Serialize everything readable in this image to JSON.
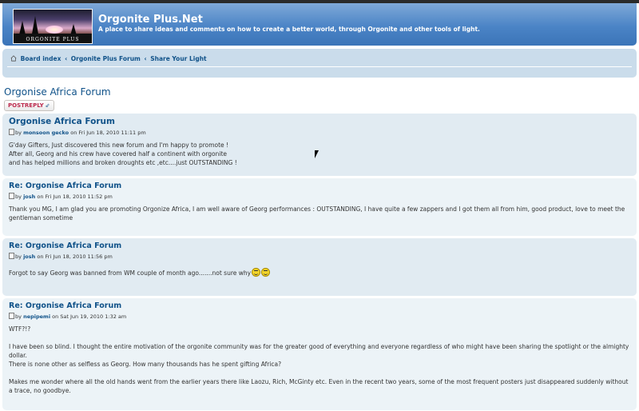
{
  "site": {
    "title": "Orgonite Plus.Net",
    "description": "A place to share ideas and comments on how to create a better world, through Orgonite and other tools of light.",
    "logo_text": "ORGONITE PLUS"
  },
  "breadcrumb": {
    "items": [
      "Board index",
      "Orgonite Plus Forum",
      "Share Your Light"
    ],
    "separator": "‹"
  },
  "forum": {
    "title": "Orgonise Africa Forum",
    "post_reply_label": "POSTREPLY"
  },
  "posts": [
    {
      "title": "Orgonise Africa Forum",
      "by": "by",
      "author": "monsoon gecko",
      "date": "on Fri Jun 18, 2010 11:11 pm",
      "lines": [
        "G'day Gifters, Just discovered this new forum and I'm happy to promote !",
        "After all, Georg and his crew have covered half a continent with orgonite",
        "and has helped millions and broken droughts etc ,etc....just OUTSTANDING !"
      ]
    },
    {
      "title": "Re: Orgonise Africa Forum",
      "by": "by",
      "author": "josh",
      "date": "on Fri Jun 18, 2010 11:52 pm",
      "lines": [
        "Thank you MG, I am glad you are promoting Orgonize Africa, I am well aware of Georg performances : OUTSTANDING, I have quite a few zappers and I got them all from him, good product, love to meet the gentleman sometime"
      ]
    },
    {
      "title": "Re: Orgonise Africa Forum",
      "by": "by",
      "author": "josh",
      "date": "on Fri Jun 18, 2010 11:56 pm",
      "lines": [
        "Forgot to say Georg was banned from WM couple of month ago.......not sure why"
      ],
      "smiley_icon": "smile-icon"
    },
    {
      "title": "Re: Orgonise Africa Forum",
      "by": "by",
      "author": "nepipemi",
      "date": "on Sat Jun 19, 2010 1:32 am",
      "lines": [
        "WTF?!?",
        "",
        "I have been so blind. I thought the entire motivation of the orgonite community was for the greater good of everything and everyone regardless of who might have been sharing the spotlight or the almighty dollar.",
        "There is none other as selfless as Georg. How many thousands has he spent gifting Africa?",
        "",
        "Makes me wonder where all the old hands went from the earlier years there like Laozu, Rich, McGinty etc. Even in the recent two years, some of the most frequent posters just disappeared suddenly without a trace, no goodbye."
      ]
    }
  ],
  "colors": {
    "header": "#4b84c6",
    "link": "#105289",
    "post_bg_a": "#e1ebf2",
    "post_bg_b": "#ecf3f7",
    "post_reply": "#bc2a4d"
  }
}
